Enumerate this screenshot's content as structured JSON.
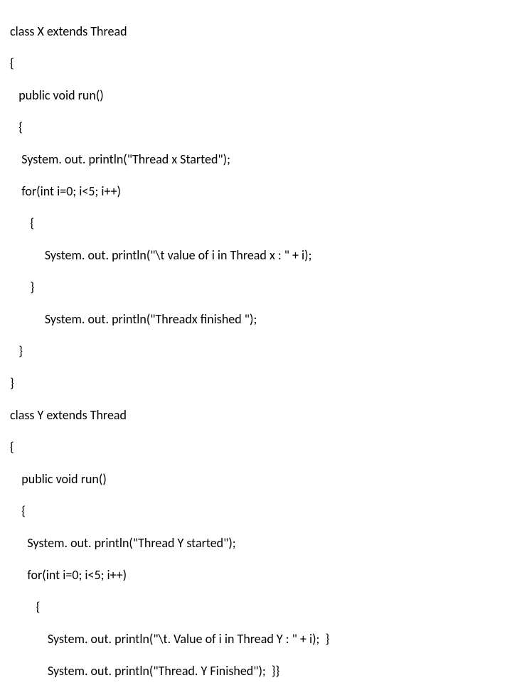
{
  "code": {
    "lines": [
      "class X extends Thread",
      "{",
      "   public void run()",
      "   {",
      "    System. out. println(\"Thread x Started\");",
      "    for(int i=0; i<5; i++)",
      "       {",
      "            System. out. println(\"\\t value of i in Thread x : \" + i);",
      "       }",
      "            System. out. println(\"Threadx finished \");",
      "   }",
      "}",
      "class Y extends Thread",
      "{",
      "    public void run()",
      "    {",
      "      System. out. println(\"Thread Y started\");",
      "      for(int i=0; i<5; i++)",
      "         {",
      "             System. out. println(\"\\t. Value of i in Thread Y : \" + i);  }",
      "             System. out. println(\"Thread. Y Finished\");  }}"
    ]
  }
}
